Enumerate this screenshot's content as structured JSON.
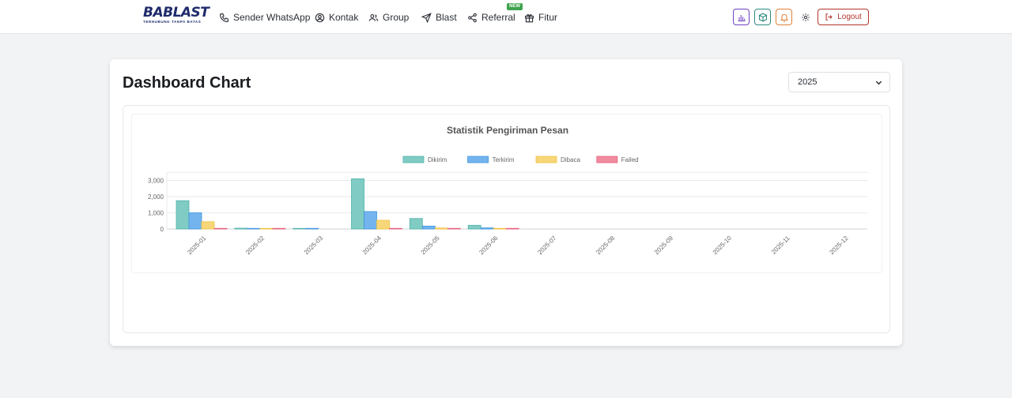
{
  "brand": {
    "name": "BABLAST",
    "tagline": "TERHUBUNG TANPA BATAS"
  },
  "nav": {
    "items": [
      {
        "label": "Sender WhatsApp",
        "icon": "phone-icon"
      },
      {
        "label": "Kontak",
        "icon": "user-circle-icon"
      },
      {
        "label": "Group",
        "icon": "users-icon"
      },
      {
        "label": "Blast",
        "icon": "send-icon"
      },
      {
        "label": "Referral",
        "icon": "share-icon",
        "badge": "NEW"
      },
      {
        "label": "Fitur",
        "icon": "gift-icon"
      }
    ],
    "logout_label": "Logout"
  },
  "dashboard": {
    "title": "Dashboard Chart",
    "year": "2025"
  },
  "chart_data": {
    "type": "bar",
    "title": "Statistik Pengiriman Pesan",
    "xlabel": "",
    "ylabel": "",
    "categories": [
      "2025-01",
      "2025-02",
      "2025-03",
      "2025-04",
      "2025-05",
      "2025-06",
      "2025-07",
      "2025-08",
      "2025-09",
      "2025-10",
      "2025-11",
      "2025-12"
    ],
    "series": [
      {
        "name": "Dikirim",
        "color": "#80cbc4",
        "stroke": "#4fb3aa",
        "values": [
          1750,
          50,
          10,
          3100,
          650,
          230,
          0,
          0,
          0,
          0,
          0,
          0
        ]
      },
      {
        "name": "Terkirim",
        "color": "#74b4ee",
        "stroke": "#3f95e0",
        "values": [
          1000,
          35,
          5,
          1080,
          180,
          70,
          0,
          0,
          0,
          0,
          0,
          0
        ]
      },
      {
        "name": "Dibaca",
        "color": "#f8d77a",
        "stroke": "#f0c23f",
        "values": [
          450,
          10,
          0,
          540,
          60,
          40,
          0,
          0,
          0,
          0,
          0,
          0
        ]
      },
      {
        "name": "Failed",
        "color": "#f08ca0",
        "stroke": "#e85d7a",
        "values": [
          40,
          5,
          0,
          10,
          5,
          10,
          0,
          0,
          0,
          0,
          0,
          0
        ]
      }
    ],
    "yticks": [
      "0",
      "1,000",
      "2,000",
      "3,000"
    ],
    "ylim": [
      0,
      3500
    ],
    "grid": true,
    "legend": "top"
  }
}
